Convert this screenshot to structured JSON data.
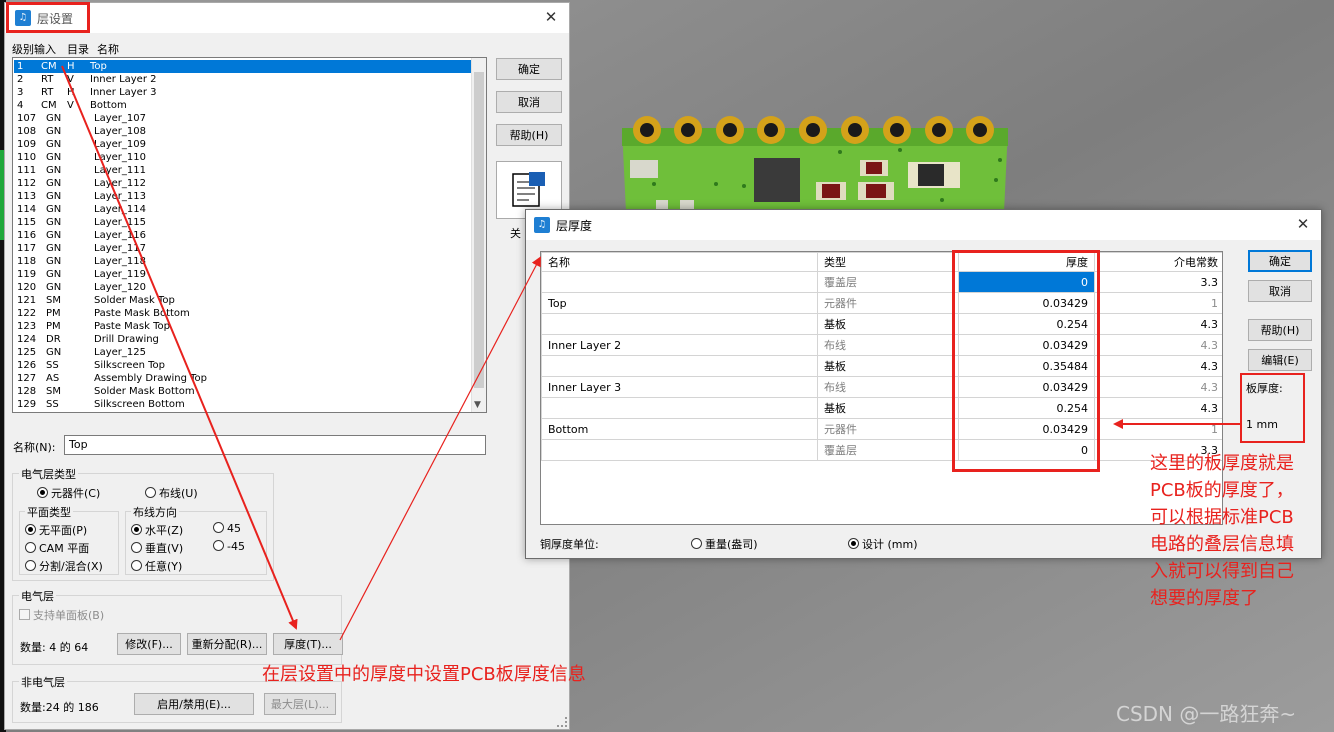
{
  "layer_dialog": {
    "title": "层设置",
    "header_labels": [
      "级别输入",
      "目录",
      "名称"
    ],
    "layers": [
      {
        "level": "1",
        "type": "CM",
        "dir": "H",
        "name": "Top"
      },
      {
        "level": "2",
        "type": "RT",
        "dir": "V",
        "name": "Inner Layer 2"
      },
      {
        "level": "3",
        "type": "RT",
        "dir": "H",
        "name": "Inner Layer 3"
      },
      {
        "level": "4",
        "type": "CM",
        "dir": "V",
        "name": "Bottom"
      },
      {
        "level": "107",
        "type": "GN",
        "dir": "",
        "name": "Layer_107"
      },
      {
        "level": "108",
        "type": "GN",
        "dir": "",
        "name": "Layer_108"
      },
      {
        "level": "109",
        "type": "GN",
        "dir": "",
        "name": "Layer_109"
      },
      {
        "level": "110",
        "type": "GN",
        "dir": "",
        "name": "Layer_110"
      },
      {
        "level": "111",
        "type": "GN",
        "dir": "",
        "name": "Layer_111"
      },
      {
        "level": "112",
        "type": "GN",
        "dir": "",
        "name": "Layer_112"
      },
      {
        "level": "113",
        "type": "GN",
        "dir": "",
        "name": "Layer_113"
      },
      {
        "level": "114",
        "type": "GN",
        "dir": "",
        "name": "Layer_114"
      },
      {
        "level": "115",
        "type": "GN",
        "dir": "",
        "name": "Layer_115"
      },
      {
        "level": "116",
        "type": "GN",
        "dir": "",
        "name": "Layer_116"
      },
      {
        "level": "117",
        "type": "GN",
        "dir": "",
        "name": "Layer_117"
      },
      {
        "level": "118",
        "type": "GN",
        "dir": "",
        "name": "Layer_118"
      },
      {
        "level": "119",
        "type": "GN",
        "dir": "",
        "name": "Layer_119"
      },
      {
        "level": "120",
        "type": "GN",
        "dir": "",
        "name": "Layer_120"
      },
      {
        "level": "121",
        "type": "SM",
        "dir": "",
        "name": "Solder Mask Top"
      },
      {
        "level": "122",
        "type": "PM",
        "dir": "",
        "name": "Paste Mask Bottom"
      },
      {
        "level": "123",
        "type": "PM",
        "dir": "",
        "name": "Paste Mask Top"
      },
      {
        "level": "124",
        "type": "DR",
        "dir": "",
        "name": "Drill Drawing"
      },
      {
        "level": "125",
        "type": "GN",
        "dir": "",
        "name": "Layer_125"
      },
      {
        "level": "126",
        "type": "SS",
        "dir": "",
        "name": "Silkscreen Top"
      },
      {
        "level": "127",
        "type": "AS",
        "dir": "",
        "name": "Assembly Drawing Top"
      },
      {
        "level": "128",
        "type": "SM",
        "dir": "",
        "name": "Solder Mask Bottom"
      },
      {
        "level": "129",
        "type": "SS",
        "dir": "",
        "name": "Silkscreen Bottom"
      }
    ],
    "buttons": {
      "ok": "确定",
      "cancel": "取消",
      "help": "帮助(H)",
      "close_partial": "关"
    },
    "name_label": "名称(N):",
    "name_value": "Top",
    "elec_type": {
      "title": "电气层类型",
      "component": "元器件(C)",
      "routing": "布线(U)"
    },
    "plane_type": {
      "title": "平面类型",
      "none": "无平面(P)",
      "cam": "CAM 平面",
      "split": "分割/混合(X)"
    },
    "route_dir": {
      "title": "布线方向",
      "horizontal": "水平(Z)",
      "vertical": "垂直(V)",
      "any": "任意(Y)",
      "p45": "45",
      "m45": "-45"
    },
    "elec_layer": {
      "title": "电气层",
      "single_sided": "支持单面板(B)",
      "count": "数量: 4 的 64",
      "modify": "修改(F)...",
      "reassign": "重新分配(R)...",
      "thickness": "厚度(T)..."
    },
    "nonelec": {
      "title": "非电气层",
      "count": "数量:24 的 186",
      "enable": "启用/禁用(E)...",
      "max": "最大层(L)..."
    }
  },
  "thickness_dialog": {
    "title": "层厚度",
    "columns": [
      "名称",
      "类型",
      "厚度",
      "介电常数"
    ],
    "rows": [
      {
        "name": "",
        "type": "覆盖层",
        "thickness": "0",
        "dielectric": "3.3",
        "type_gray": true,
        "diel_gray": false
      },
      {
        "name": "Top",
        "type": "元器件",
        "thickness": "0.03429",
        "dielectric": "1",
        "type_gray": true,
        "diel_gray": true
      },
      {
        "name": "",
        "type": "基板",
        "thickness": "0.254",
        "dielectric": "4.3",
        "type_gray": false,
        "diel_gray": false
      },
      {
        "name": "Inner Layer 2",
        "type": "布线",
        "thickness": "0.03429",
        "dielectric": "4.3",
        "type_gray": true,
        "diel_gray": true
      },
      {
        "name": "",
        "type": "基板",
        "thickness": "0.35484",
        "dielectric": "4.3",
        "type_gray": false,
        "diel_gray": false
      },
      {
        "name": "Inner Layer 3",
        "type": "布线",
        "thickness": "0.03429",
        "dielectric": "4.3",
        "type_gray": true,
        "diel_gray": true
      },
      {
        "name": "",
        "type": "基板",
        "thickness": "0.254",
        "dielectric": "4.3",
        "type_gray": false,
        "diel_gray": false
      },
      {
        "name": "Bottom",
        "type": "元器件",
        "thickness": "0.03429",
        "dielectric": "1",
        "type_gray": true,
        "diel_gray": true
      },
      {
        "name": "",
        "type": "覆盖层",
        "thickness": "0",
        "dielectric": "3.3",
        "type_gray": true,
        "diel_gray": false
      }
    ],
    "buttons": {
      "ok": "确定",
      "cancel": "取消",
      "help": "帮助(H)",
      "edit": "编辑(E)"
    },
    "board_thickness_label": "板厚度:",
    "board_thickness_value": "1 mm",
    "unit_label": "铜厚度单位:",
    "unit_weight": "重量(盎司)",
    "unit_design": "设计 (mm)"
  },
  "annotations": {
    "bottom_note": "在层设置中的厚度中设置PCB板厚度信息",
    "right_note": [
      "这里的板厚度就是",
      "PCB板的厚度了，",
      "可以根据标准PCB",
      "电路的叠层信息填",
      "入就可以得到自己",
      "想要的厚度了"
    ],
    "watermark": "CSDN @一路狂奔~"
  },
  "colors": {
    "annotation_red": "#e8221e",
    "selection_blue": "#0078d7",
    "pcb_green": "#6fbf3a",
    "pad_gold": "#d4a21a"
  }
}
